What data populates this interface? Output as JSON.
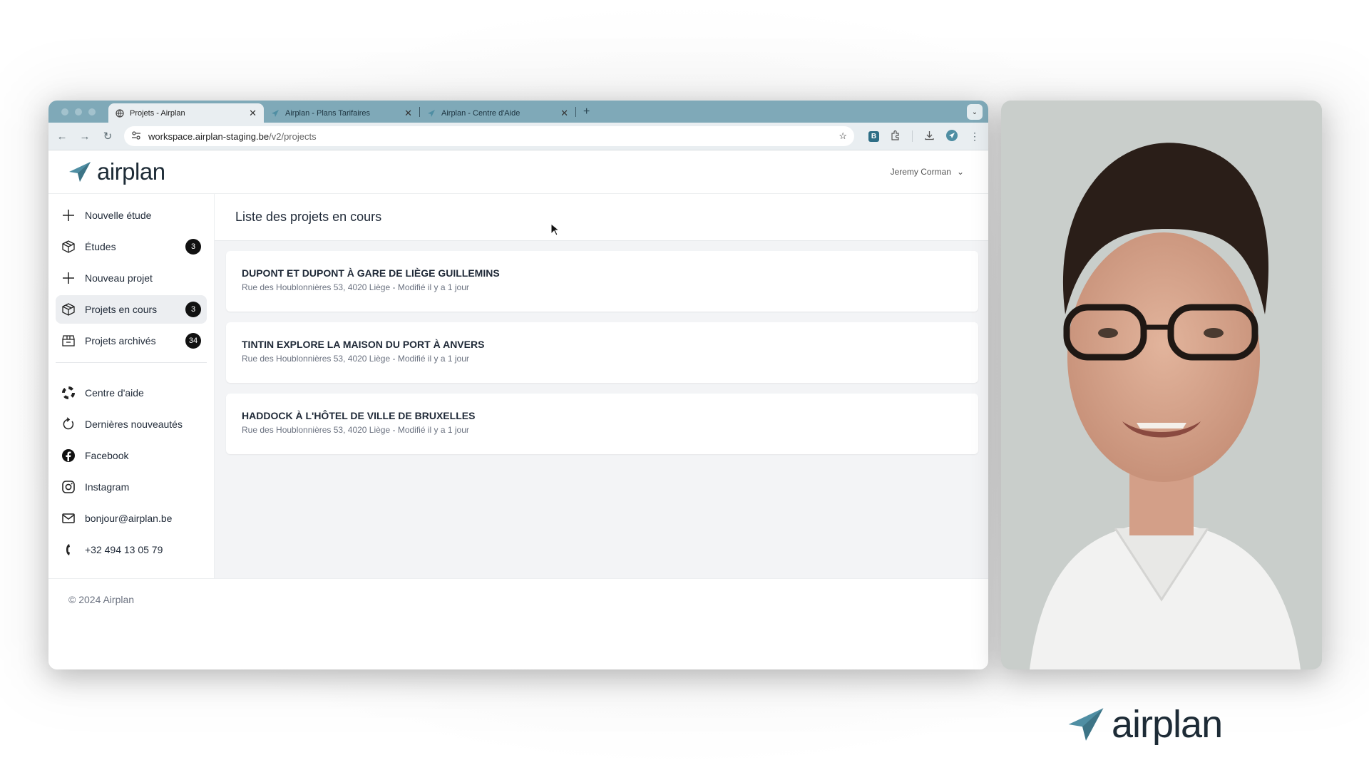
{
  "browser": {
    "tabs": [
      {
        "title": "Projets - Airplan",
        "active": true
      },
      {
        "title": "Airplan - Plans Tarifaires",
        "active": false
      },
      {
        "title": "Airplan - Centre d'Aide",
        "active": false
      }
    ],
    "url_host": "workspace.airplan-staging.be",
    "url_path": "/v2/projects",
    "close_glyph": "✕",
    "new_tab_glyph": "+"
  },
  "app": {
    "logo_text": "airplan",
    "user_name": "Jeremy Corman",
    "brand_color": "#4f8ea3"
  },
  "sidebar": {
    "items": [
      {
        "label": "Nouvelle étude",
        "icon": "plus-icon",
        "badge": null
      },
      {
        "label": "Études",
        "icon": "box-icon",
        "badge": "3"
      },
      {
        "label": "Nouveau projet",
        "icon": "plus-icon",
        "badge": null
      },
      {
        "label": "Projets en cours",
        "icon": "box-icon",
        "badge": "3",
        "active": true
      },
      {
        "label": "Projets archivés",
        "icon": "archive-box-icon",
        "badge": "34"
      }
    ],
    "links": [
      {
        "label": "Centre d'aide",
        "icon": "lifebuoy-icon"
      },
      {
        "label": "Dernières nouveautés",
        "icon": "refresh-icon"
      },
      {
        "label": "Facebook",
        "icon": "facebook-icon"
      },
      {
        "label": "Instagram",
        "icon": "instagram-icon"
      },
      {
        "label": "bonjour@airplan.be",
        "icon": "mail-icon"
      },
      {
        "label": "+32 494 13 05 79",
        "icon": "phone-icon"
      }
    ]
  },
  "main": {
    "heading": "Liste des projets en cours",
    "projects": [
      {
        "title": "DUPONT ET DUPONT À GARE DE LIÈGE GUILLEMINS",
        "subtitle": "Rue des Houblonnières 53, 4020 Liège - Modifié il y a 1 jour"
      },
      {
        "title": "TINTIN EXPLORE LA MAISON DU PORT À ANVERS",
        "subtitle": "Rue des Houblonnières 53, 4020 Liège - Modifié il y a 1 jour"
      },
      {
        "title": "HADDOCK À L'HÔTEL DE VILLE DE BRUXELLES",
        "subtitle": "Rue des Houblonnières 53, 4020 Liège - Modifié il y a 1 jour"
      }
    ]
  },
  "footer": {
    "text": "© 2024 Airplan"
  },
  "corner_brand": {
    "text": "airplan"
  }
}
